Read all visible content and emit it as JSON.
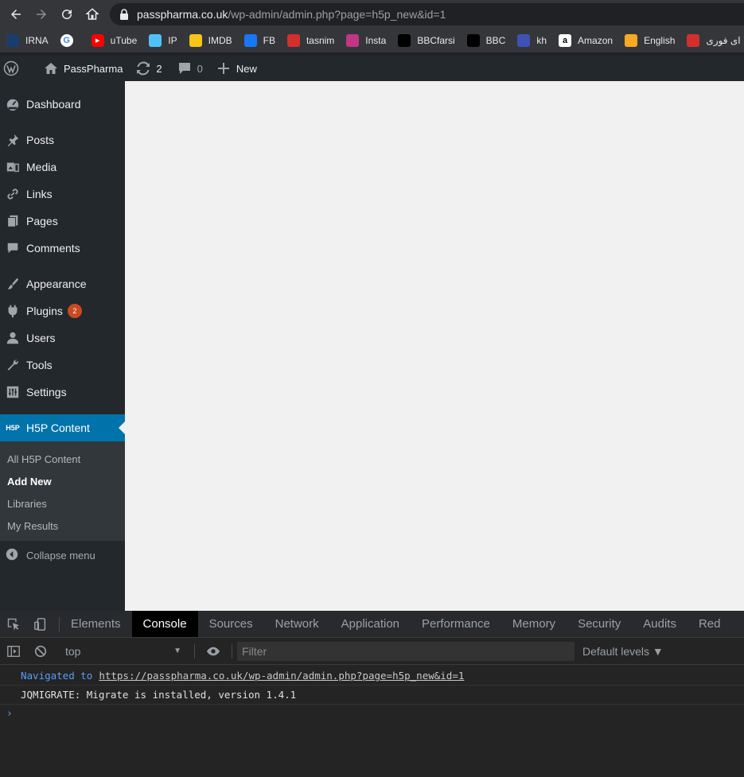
{
  "browser": {
    "url_host": "passpharma.co.uk",
    "url_path": "/wp-admin/admin.php?page=h5p_new&id=1"
  },
  "bookmarks": [
    {
      "label": "IRNA",
      "icon": "irna-icon",
      "color": "#1a3d6e"
    },
    {
      "label": "",
      "icon": "google-icon",
      "color": "#ffffff"
    },
    {
      "label": "uTube",
      "icon": "youtube-icon",
      "color": "#ff0000"
    },
    {
      "label": "IP",
      "icon": "ip-icon",
      "color": "#4fc3f7"
    },
    {
      "label": "IMDB",
      "icon": "imdb-icon",
      "color": "#f5c518"
    },
    {
      "label": "FB",
      "icon": "facebook-icon",
      "color": "#1877f2"
    },
    {
      "label": "tasnim",
      "icon": "tasnim-icon",
      "color": "#d32f2f"
    },
    {
      "label": "Insta",
      "icon": "instagram-icon",
      "color": "#c13584"
    },
    {
      "label": "BBCfarsi",
      "icon": "bbc-icon",
      "color": "#000000"
    },
    {
      "label": "BBC",
      "icon": "bbc-icon",
      "color": "#000000"
    },
    {
      "label": "kh",
      "icon": "kh-icon",
      "color": "#3f51b5"
    },
    {
      "label": "Amazon",
      "icon": "amazon-icon",
      "color": "#ffffff"
    },
    {
      "label": "English",
      "icon": "english-icon",
      "color": "#f9a825"
    },
    {
      "label": "ای فوری",
      "icon": "farsi-icon",
      "color": "#d32f2f"
    }
  ],
  "adminbar": {
    "site_name": "PassPharma",
    "updates": "2",
    "comments": "0",
    "new_label": "New"
  },
  "sidebar": {
    "items": [
      {
        "label": "Dashboard",
        "icon": "dashboard-icon"
      },
      {
        "label": "Posts",
        "icon": "pin-icon"
      },
      {
        "label": "Media",
        "icon": "media-icon"
      },
      {
        "label": "Links",
        "icon": "link-icon"
      },
      {
        "label": "Pages",
        "icon": "pages-icon"
      },
      {
        "label": "Comments",
        "icon": "comment-icon"
      },
      {
        "label": "Appearance",
        "icon": "brush-icon"
      },
      {
        "label": "Plugins",
        "icon": "plugin-icon",
        "badge": "2"
      },
      {
        "label": "Users",
        "icon": "user-icon"
      },
      {
        "label": "Tools",
        "icon": "wrench-icon"
      },
      {
        "label": "Settings",
        "icon": "settings-icon"
      },
      {
        "label": "H5P Content",
        "icon": "h5p-icon"
      }
    ],
    "h5p_icon_text": "H5P",
    "submenu": [
      "All H5P Content",
      "Add New",
      "Libraries",
      "My Results"
    ],
    "collapse_label": "Collapse menu"
  },
  "devtools": {
    "tabs": [
      "Elements",
      "Console",
      "Sources",
      "Network",
      "Application",
      "Performance",
      "Memory",
      "Security",
      "Audits",
      "Red"
    ],
    "context": "top",
    "filter_placeholder": "Filter",
    "levels": "Default levels ▼",
    "console": {
      "nav_text": "Navigated to",
      "nav_url": "https://passpharma.co.uk/wp-admin/admin.php?page=h5p_new&id=1",
      "log": "JQMIGRATE: Migrate is installed, version 1.4.1",
      "prompt": "›"
    }
  },
  "colors": {
    "wp_blue": "#0073aa",
    "admin_dark": "#23282d",
    "badge_orange": "#ca4a1f"
  }
}
